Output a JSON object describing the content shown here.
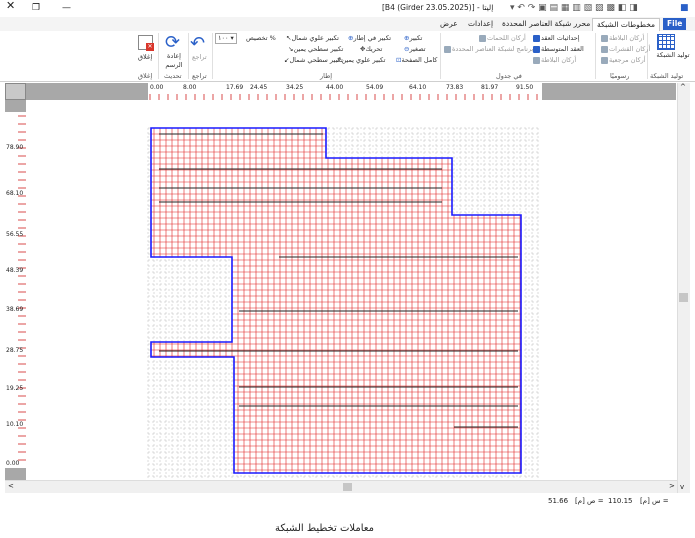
{
  "titlebar": {
    "title": "[B4 (Girder 23.05.2025)] - إليتا",
    "close": "✕",
    "restore": "❐",
    "minimize": "—",
    "help": "?"
  },
  "tabs": [
    "File",
    "مخطوطات الشبكة",
    "محرر شبكة العناصر المحددة",
    "إعدادات",
    "عرض"
  ],
  "ribbon": {
    "generate_label": "توليد الشبكة",
    "generate_group": "توليد الشبكة",
    "slab_edges": "أركان البلاطة",
    "beam_edges": "أركان القشرات",
    "ref_edges": "أركان مرجعية",
    "draw_group": "رسوميًا",
    "node_coords": "إحداثيات العقد",
    "slab_edges2": "أركان اللحمات",
    "mid_nodes": "العقد المتوسطة",
    "elem_program": "برنامج لشبكة العناصر المحددة",
    "slab_edges3": "أركان البلاطة",
    "table_group": "في جدول",
    "zoom_in": "تكبير",
    "zoom_out": "تصغير",
    "full_page": "كامل الصفحة",
    "zoom_window": "تكبير في إطار",
    "pan": "تحريك",
    "zoom_top_left": "تكبير علوي يمين",
    "zoom_top_right": "تكبير علوي شمال",
    "zoom_bottom_right": "تكبير سطحي يمين",
    "zoom_bottom_left": "تكبير سطحي شمال",
    "zoom_value": "١٠٠",
    "zoom_label": "تخصيص %",
    "frame_group": "إطار",
    "undo": "تراجع",
    "undo_group": "تراجع",
    "redraw": "إعادة الرسم",
    "update_group": "تحديث",
    "close": "إغلاق",
    "close_group": "إغلاق"
  },
  "ruler_top": [
    "0.00",
    "8.00",
    "17.69",
    "24.45",
    "34.25",
    "44.00",
    "54.09",
    "64.10",
    "73.83",
    "81.97",
    "91.50"
  ],
  "ruler_left": [
    "78.90",
    "68.10",
    "56.55",
    "48.39",
    "38.69",
    "28.75",
    "19.25",
    "10.10",
    "0.00"
  ],
  "status": {
    "x_label": "س [م] =",
    "x_value": "110.15",
    "y_label": "ص [م] =",
    "y_value": "51.66",
    "footer_text": "معاملات تخطيط الشبكة"
  },
  "colors": {
    "accent": "#2a60c8",
    "boundary": "#1a1aff",
    "grid_red": "#e02020",
    "grid_gray": "#b8b8b8",
    "beam": "#222222"
  }
}
